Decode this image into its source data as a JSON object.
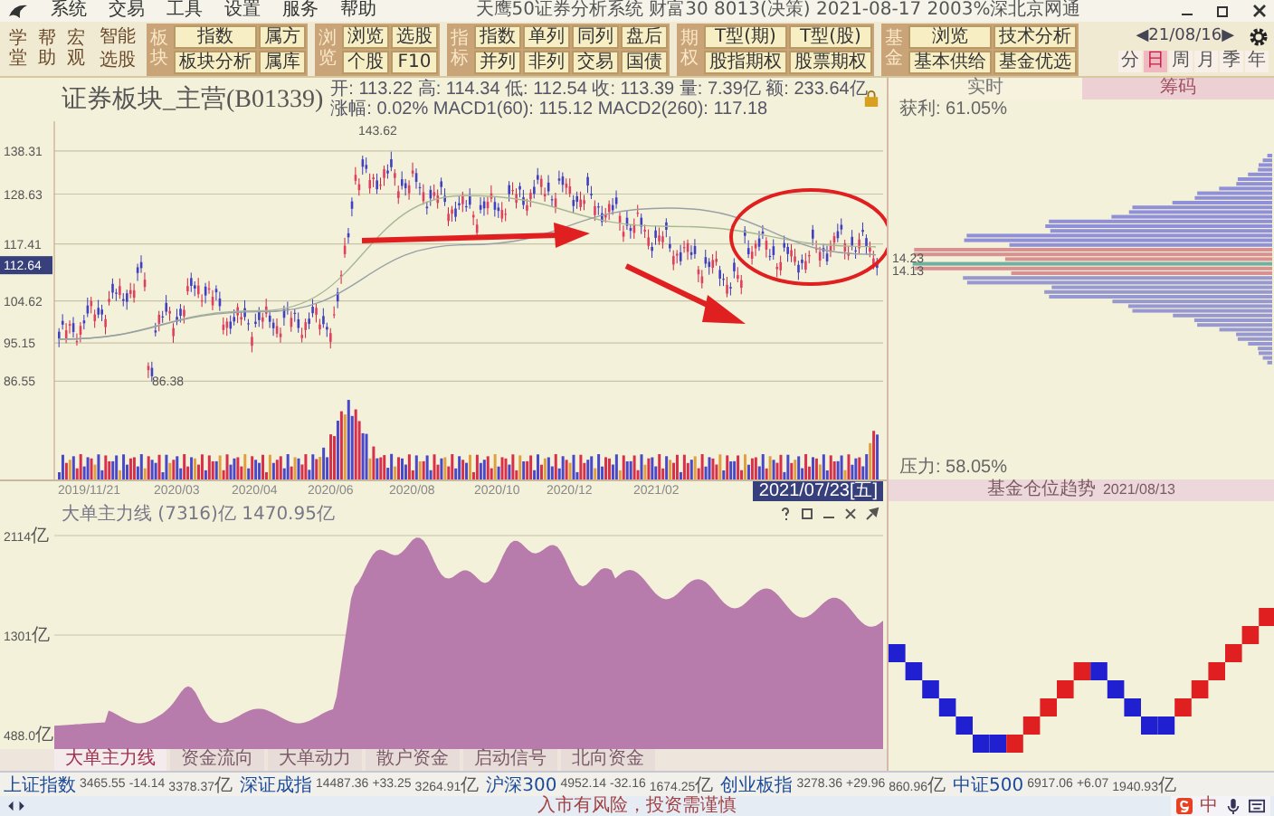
{
  "menu": {
    "items": [
      "系统",
      "交易",
      "工具",
      "设置",
      "服务",
      "帮助"
    ],
    "title": "天鹰50证券分析系统  财富30 8013(决策)  2021-08-17  2003%深北京网通"
  },
  "toolbar": {
    "side": [
      "学堂",
      "帮助",
      "宏观"
    ],
    "smart": [
      "智能",
      "选股"
    ],
    "groups": [
      {
        "label": "板块",
        "buttons": [
          "指数",
          "属方",
          "板块分析",
          "属库"
        ]
      },
      {
        "label": "浏览",
        "buttons": [
          "浏览",
          "选股",
          "个股",
          "F10"
        ]
      },
      {
        "label": "指标",
        "buttons": [
          "指数",
          "单列",
          "同列",
          "盘后",
          "并列",
          "非列",
          "交易",
          "国债"
        ]
      },
      {
        "label": "期权",
        "buttons": [
          "T型(期)",
          "T型(股)",
          "股指期权",
          "股票期权"
        ]
      },
      {
        "label": "基金",
        "buttons": [
          "浏览",
          "技术分析",
          "基本供给",
          "基金优选"
        ]
      }
    ]
  },
  "nav": {
    "date": "◀21/08/16▶",
    "periods": [
      {
        "label": "分",
        "selected": false
      },
      {
        "label": "日",
        "selected": true
      },
      {
        "label": "周",
        "selected": false
      },
      {
        "label": "月",
        "selected": false
      },
      {
        "label": "季",
        "selected": false
      },
      {
        "label": "年",
        "selected": false
      }
    ]
  },
  "chart": {
    "title": "证券板块_主营(B01339)",
    "info": [
      "开: 113.22 高: 114.34 低: 112.54 收: 113.39 量: 7.39亿 额: 233.64亿",
      "涨幅: 0.02% MACD1(60): 115.12 MACD2(260): 117.18"
    ],
    "yticks": [
      "138.31",
      "128.63",
      "117.41",
      "104.62",
      "95.15",
      "86.55"
    ],
    "price_tag": "112.64",
    "high_label": "143.62",
    "low_label": "86.38",
    "dates": [
      "2019/11/21",
      "2020/03",
      "2020/04",
      "2020/06",
      "2020/08",
      "2020/10",
      "2020/12",
      "2021/02"
    ],
    "cursor_date": "2021/07/23[五]"
  },
  "indicator": {
    "title": "大单主力线 (7316)亿 1470.95亿",
    "yticks": [
      {
        "value": "2114",
        "unit": "亿"
      },
      {
        "value": "1301",
        "unit": "亿"
      },
      {
        "value": "488.0",
        "unit": "亿"
      }
    ]
  },
  "bottom_tabs": [
    {
      "label": "大单主力线",
      "selected": true
    },
    {
      "label": "资金流向",
      "selected": false
    },
    {
      "label": "大单动力",
      "selected": false
    },
    {
      "label": "散户资金",
      "selected": false
    },
    {
      "label": "启动信号",
      "selected": false
    },
    {
      "label": "北向资金",
      "selected": false
    }
  ],
  "right": {
    "tabs": [
      {
        "label": "实时",
        "selected": false
      },
      {
        "label": "筹码",
        "selected": true
      }
    ],
    "profit": "获利: 61.05%",
    "prices": [
      "14.23",
      "14.13"
    ],
    "pressure": "压力: 58.05%",
    "fund_title": "基金仓位趋势",
    "fund_date": "2021/08/13"
  },
  "status": [
    {
      "name": "上证指数",
      "price": "3465.55",
      "change": "-14.14",
      "amount": "3378.37",
      "unit": "亿"
    },
    {
      "name": "深证成指",
      "price": "14487.36",
      "change": "+33.25",
      "amount": "3264.91",
      "unit": "亿"
    },
    {
      "name": "沪深300",
      "price": "4952.14",
      "change": "-32.16",
      "amount": "1674.25",
      "unit": "亿"
    },
    {
      "name": "创业板指",
      "price": "3278.36",
      "change": "+29.96",
      "amount": "860.96",
      "unit": "亿"
    },
    {
      "name": "中证500",
      "price": "6917.06",
      "change": "+6.07",
      "amount": "1940.93",
      "unit": "亿"
    }
  ],
  "ime": {
    "label": "中"
  },
  "footer": "入市有风险，投资需谨慎"
}
